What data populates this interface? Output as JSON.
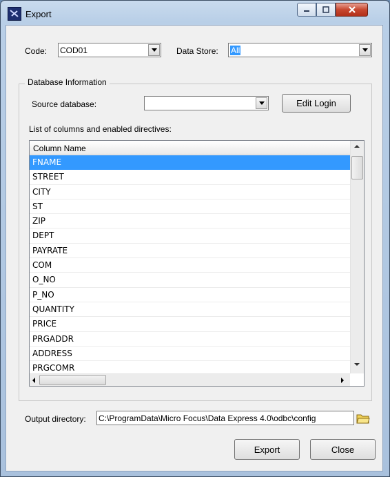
{
  "window": {
    "title": "Export"
  },
  "code": {
    "label": "Code:",
    "value": "COD01"
  },
  "data_store": {
    "label": "Data Store:",
    "value": "All"
  },
  "database_info": {
    "group_title": "Database Information",
    "source_label": "Source database:",
    "source_value": "",
    "edit_login_label": "Edit Login",
    "list_label": "List of columns and enabled directives:"
  },
  "columns": {
    "header": "Column Name",
    "rows": [
      "FNAME",
      "STREET",
      "CITY",
      "ST",
      "ZIP",
      "DEPT",
      "PAYRATE",
      "COM",
      "O_NO",
      "P_NO",
      "QUANTITY",
      "PRICE",
      "PRGADDR",
      "ADDRESS",
      "PRGCOMR"
    ],
    "selected": "FNAME"
  },
  "output": {
    "label": "Output directory:",
    "value": "C:\\ProgramData\\Micro Focus\\Data Express 4.0\\odbc\\config"
  },
  "buttons": {
    "export": "Export",
    "close": "Close"
  },
  "colors": {
    "selection": "#3399ff",
    "window_frame": "#b9cfe7"
  }
}
